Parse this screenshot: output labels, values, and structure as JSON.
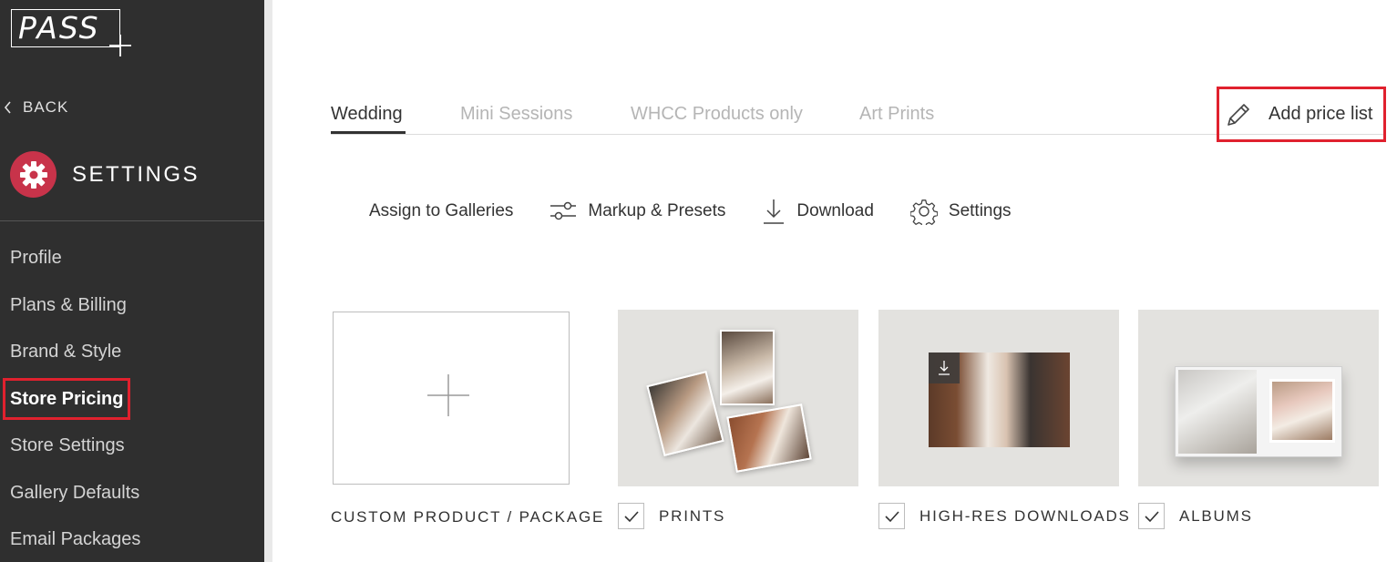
{
  "sidebar": {
    "logo_text": "PASS",
    "back_label": "BACK",
    "section_title": "SETTINGS",
    "items": [
      {
        "label": "Profile"
      },
      {
        "label": "Plans & Billing"
      },
      {
        "label": "Brand & Style"
      },
      {
        "label": "Store Pricing"
      },
      {
        "label": "Store Settings"
      },
      {
        "label": "Gallery Defaults"
      },
      {
        "label": "Email Packages"
      }
    ],
    "active_item": "Store Pricing"
  },
  "tabs": [
    {
      "label": "Wedding"
    },
    {
      "label": "Mini Sessions"
    },
    {
      "label": "WHCC Products only"
    },
    {
      "label": "Art Prints"
    }
  ],
  "active_tab": "Wedding",
  "add_price_list_label": "Add price list",
  "toolbar": {
    "assign_label": "Assign to Galleries",
    "markup_label": "Markup & Presets",
    "download_label": "Download",
    "settings_label": "Settings"
  },
  "products": [
    {
      "label": "CUSTOM PRODUCT / PACKAGE",
      "checked": null
    },
    {
      "label": "PRINTS",
      "checked": true
    },
    {
      "label": "HIGH-RES DOWNLOADS",
      "checked": true
    },
    {
      "label": "ALBUMS",
      "checked": true
    }
  ],
  "colors": {
    "sidebar_bg": "#2f2f2f",
    "accent": "#c8334a",
    "highlight_box": "#e0212e"
  }
}
